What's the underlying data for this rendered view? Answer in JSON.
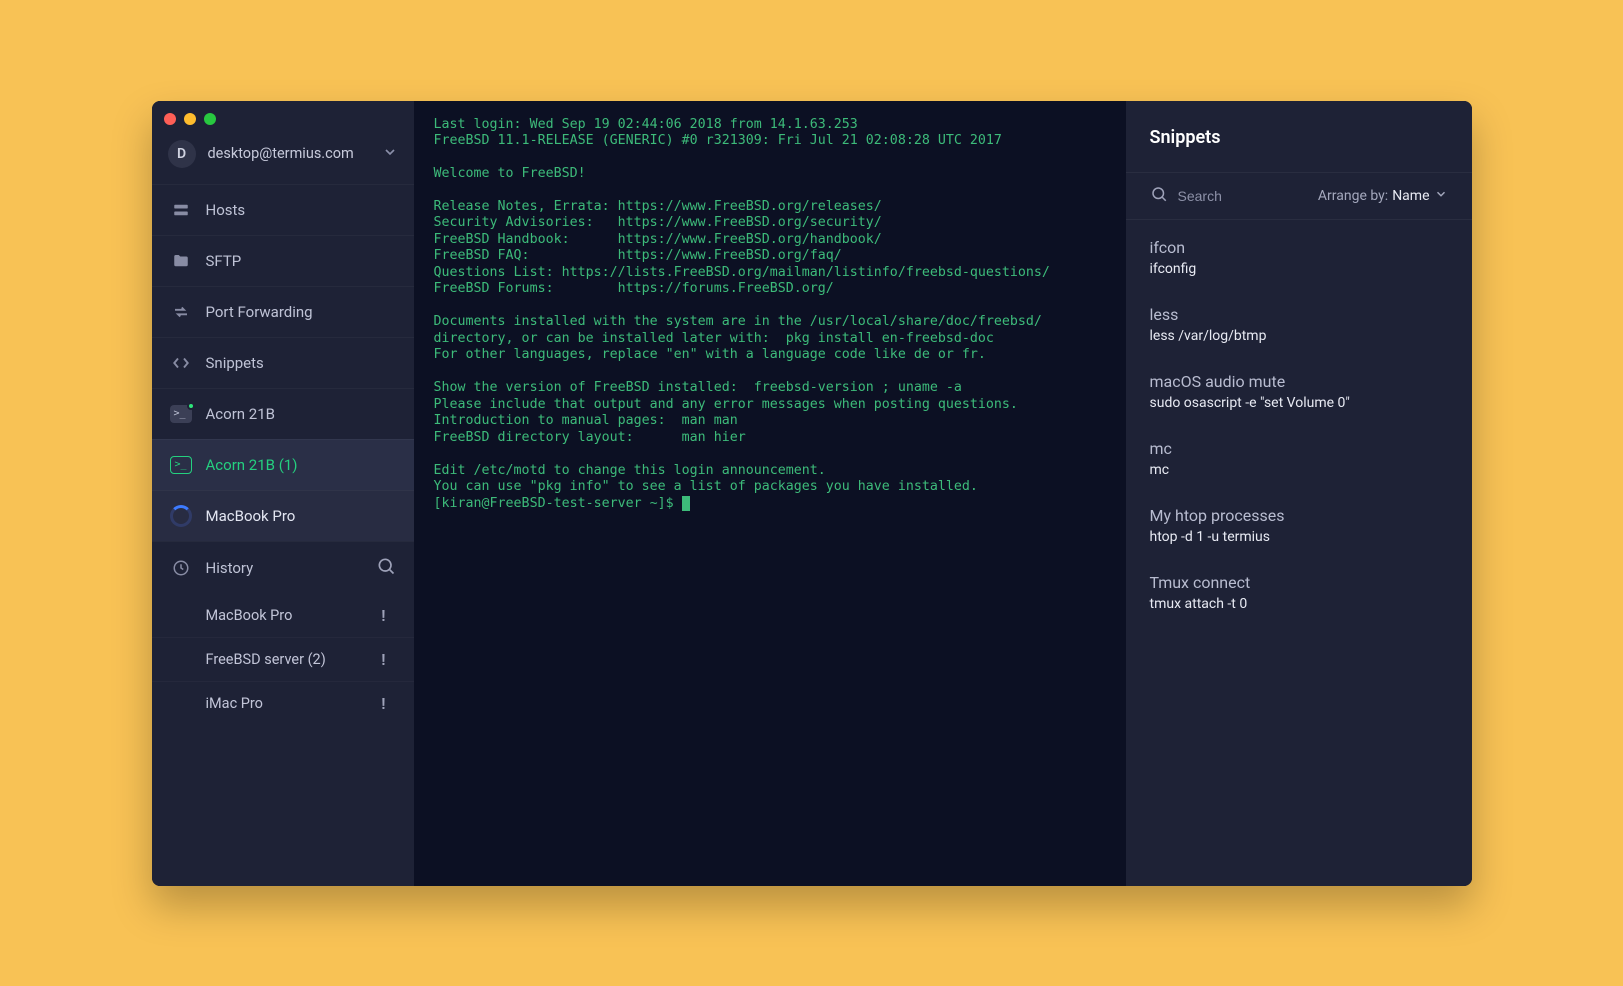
{
  "account": {
    "avatar_letter": "D",
    "label": "desktop@termius.com"
  },
  "nav": {
    "hosts": "Hosts",
    "sftp": "SFTP",
    "port_forwarding": "Port Forwarding",
    "snippets": "Snippets"
  },
  "sessions": [
    {
      "label": "Acorn 21B"
    },
    {
      "label": "Acorn 21B (1)"
    },
    {
      "label": "MacBook Pro"
    }
  ],
  "history": {
    "header": "History",
    "items": [
      {
        "label": "MacBook Pro"
      },
      {
        "label": "FreeBSD server (2)"
      },
      {
        "label": "iMac Pro"
      }
    ]
  },
  "terminal": {
    "text": "Last login: Wed Sep 19 02:44:06 2018 from 14.1.63.253\nFreeBSD 11.1-RELEASE (GENERIC) #0 r321309: Fri Jul 21 02:08:28 UTC 2017\n\nWelcome to FreeBSD!\n\nRelease Notes, Errata: https://www.FreeBSD.org/releases/\nSecurity Advisories:   https://www.FreeBSD.org/security/\nFreeBSD Handbook:      https://www.FreeBSD.org/handbook/\nFreeBSD FAQ:           https://www.FreeBSD.org/faq/\nQuestions List: https://lists.FreeBSD.org/mailman/listinfo/freebsd-questions/\nFreeBSD Forums:        https://forums.FreeBSD.org/\n\nDocuments installed with the system are in the /usr/local/share/doc/freebsd/\ndirectory, or can be installed later with:  pkg install en-freebsd-doc\nFor other languages, replace \"en\" with a language code like de or fr.\n\nShow the version of FreeBSD installed:  freebsd-version ; uname -a\nPlease include that output and any error messages when posting questions.\nIntroduction to manual pages:  man man\nFreeBSD directory layout:      man hier\n\nEdit /etc/motd to change this login announcement.\nYou can use \"pkg info\" to see a list of packages you have installed.\n[kiran@FreeBSD-test-server ~]$ "
  },
  "panel": {
    "title": "Snippets",
    "search_placeholder": "Search",
    "arrange_label": "Arrange by:",
    "arrange_value": "Name"
  },
  "snippets": [
    {
      "title": "ifcon",
      "cmd": "ifconfig"
    },
    {
      "title": "less",
      "cmd": "less /var/log/btmp"
    },
    {
      "title": "macOS audio mute",
      "cmd": "sudo osascript -e \"set Volume 0\""
    },
    {
      "title": "mc",
      "cmd": "mc"
    },
    {
      "title": "My htop processes",
      "cmd": "htop -d 1 -u termius"
    },
    {
      "title": "Tmux connect",
      "cmd": "tmux attach -t 0"
    }
  ]
}
